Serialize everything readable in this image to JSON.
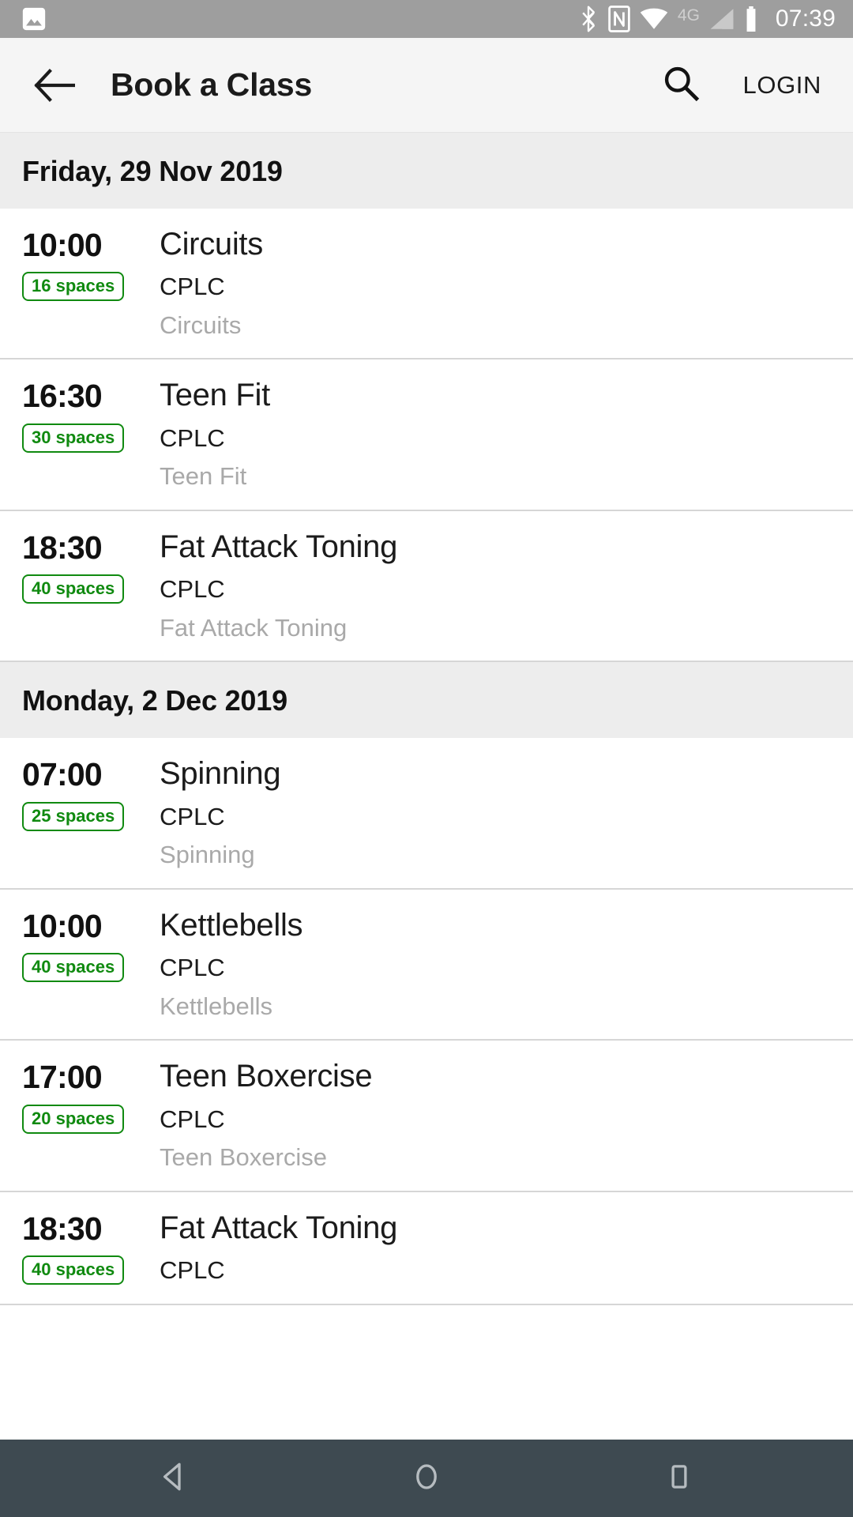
{
  "status_bar": {
    "background_color": "#9e9e9e",
    "time": "07:39",
    "icons": [
      {
        "name": "photo-icon",
        "position": "left"
      },
      {
        "name": "bluetooth-icon",
        "position": "right"
      },
      {
        "name": "nfc-icon",
        "position": "right"
      },
      {
        "name": "wifi-icon",
        "position": "right"
      },
      {
        "name": "mobile-network-4g-icon",
        "label": "4G",
        "position": "right"
      },
      {
        "name": "cell-signal-icon",
        "position": "right"
      },
      {
        "name": "battery-icon",
        "position": "right"
      }
    ],
    "network_label": "4G"
  },
  "app_bar": {
    "background_color": "#f5f5f5",
    "back_label": "",
    "title": "Book a Class",
    "search_label": "",
    "login_label": "LOGIN"
  },
  "theme": {
    "badge_green": "#108a10",
    "date_header_bg": "#ededed",
    "divider": "#d6d6d6",
    "muted_text": "#a9a9a9",
    "nav_bar_bg": "#3e4a51"
  },
  "schedule": [
    {
      "date": "Friday, 29 Nov 2019",
      "classes": [
        {
          "time": "10:00",
          "spaces": "16 spaces",
          "name": "Circuits",
          "venue": "CPLC",
          "description": "Circuits"
        },
        {
          "time": "16:30",
          "spaces": "30 spaces",
          "name": "Teen Fit",
          "venue": "CPLC",
          "description": "Teen Fit"
        },
        {
          "time": "18:30",
          "spaces": "40 spaces",
          "name": "Fat Attack Toning",
          "venue": "CPLC",
          "description": "Fat Attack Toning"
        }
      ]
    },
    {
      "date": "Monday, 2 Dec 2019",
      "classes": [
        {
          "time": "07:00",
          "spaces": "25 spaces",
          "name": "Spinning",
          "venue": "CPLC",
          "description": "Spinning"
        },
        {
          "time": "10:00",
          "spaces": "40 spaces",
          "name": "Kettlebells",
          "venue": "CPLC",
          "description": "Kettlebells"
        },
        {
          "time": "17:00",
          "spaces": "20 spaces",
          "name": "Teen Boxercise",
          "venue": "CPLC",
          "description": "Teen Boxercise"
        },
        {
          "time": "18:30",
          "spaces": "40 spaces",
          "name": "Fat Attack Toning",
          "venue": "CPLC",
          "description": ""
        }
      ]
    }
  ],
  "nav_bar": {
    "buttons": [
      {
        "name": "back-nav-button",
        "label": ""
      },
      {
        "name": "home-nav-button",
        "label": ""
      },
      {
        "name": "recents-nav-button",
        "label": ""
      }
    ]
  }
}
